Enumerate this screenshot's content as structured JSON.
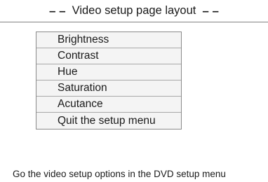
{
  "header": {
    "title": "Video setup page layout",
    "left_marker": "– –",
    "right_marker": "– –"
  },
  "menu": {
    "items": [
      {
        "label": "Brightness"
      },
      {
        "label": "Contrast"
      },
      {
        "label": "Hue"
      },
      {
        "label": "Saturation"
      },
      {
        "label": "Acutance"
      },
      {
        "label": "Quit the setup menu"
      }
    ]
  },
  "status_bar": {
    "text": "Go the video setup options in the DVD setup menu"
  }
}
